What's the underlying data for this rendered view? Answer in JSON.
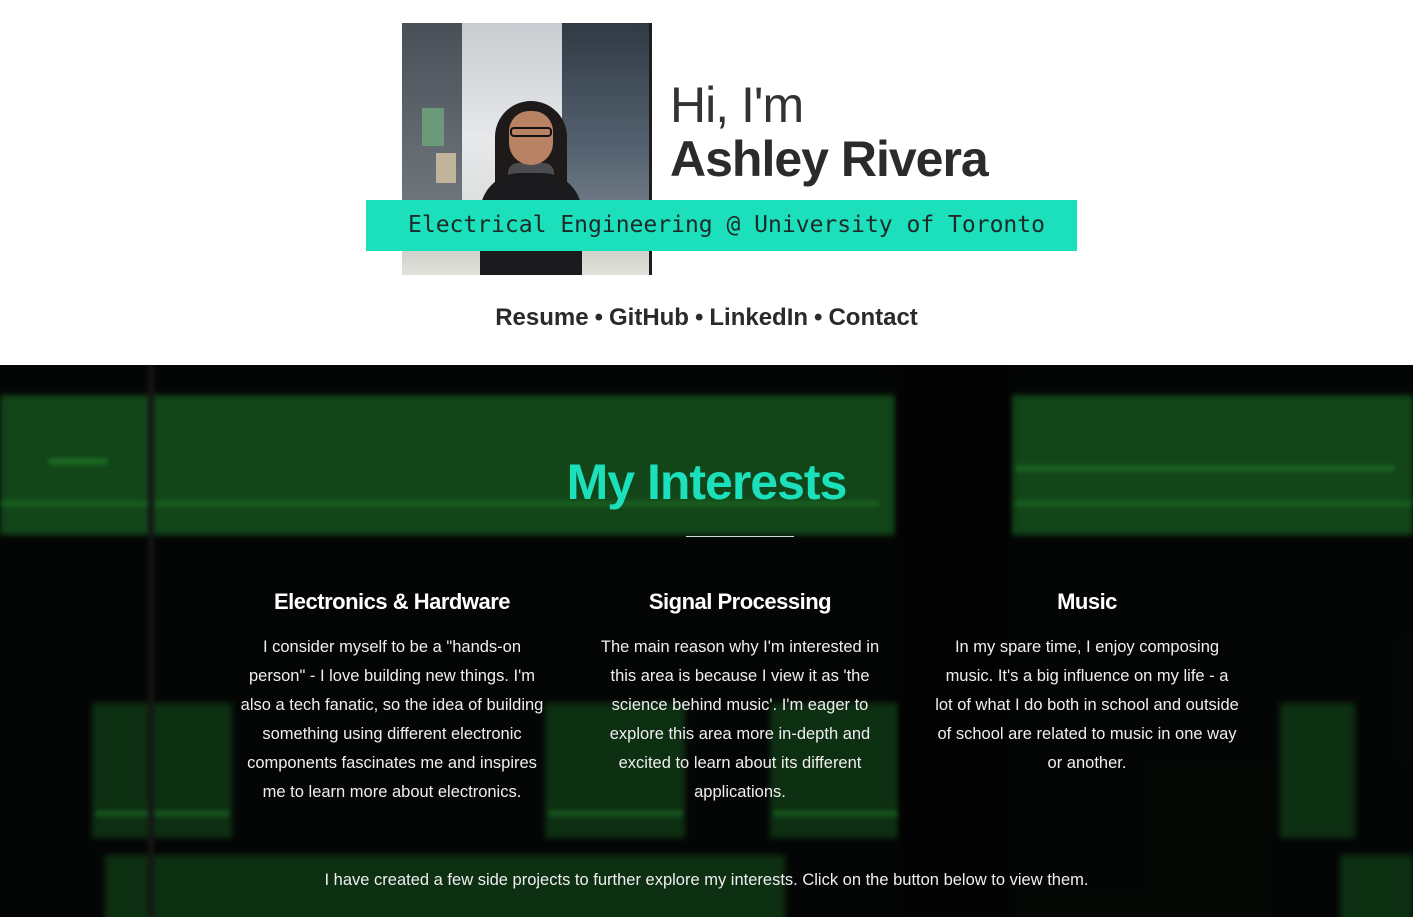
{
  "header": {
    "greeting": "Hi, I'm",
    "name": "Ashley Rivera",
    "tagline": "Electrical Engineering @ University of Toronto",
    "nav": [
      {
        "label": "Resume"
      },
      {
        "label": "GitHub"
      },
      {
        "label": "LinkedIn"
      },
      {
        "label": "Contact"
      }
    ],
    "separator": "•"
  },
  "interests": {
    "title": "My Interests",
    "items": [
      {
        "title": "Electronics & Hardware",
        "text": "I consider myself to be a \"hands-on person\" - I love building new things. I'm also a tech fanatic, so the idea of building something using different electronic components fascinates me and inspires me to learn more about electronics."
      },
      {
        "title": "Signal Processing",
        "text": "The main reason why I'm interested in this area is because I view it as 'the science behind music'. I'm eager to explore this area more in-depth and excited to learn about its different applications."
      },
      {
        "title": "Music",
        "text": "In my spare time, I enjoy composing music. It's a big influence on my life - a lot of what I do both in school and outside of school are related to music in one way or another."
      }
    ],
    "footer_note": "I have created a few side projects to further explore my interests. Click on the button below to view them."
  },
  "colors": {
    "accent": "#1be0bb",
    "text_dark": "#2b2b2b",
    "section_bg": "#070a08"
  }
}
